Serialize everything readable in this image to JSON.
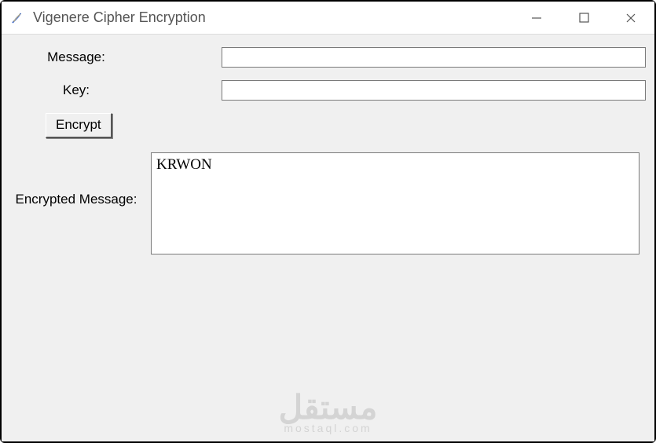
{
  "window": {
    "title": "Vigenere Cipher Encryption"
  },
  "labels": {
    "message": "Message:",
    "key": "Key:",
    "encrypted": "Encrypted Message:"
  },
  "buttons": {
    "encrypt": "Encrypt"
  },
  "inputs": {
    "message_value": "",
    "key_value": ""
  },
  "output": {
    "encrypted_text": "KRWON"
  },
  "watermark": {
    "brand": "مستقل",
    "sub": "mostaql.com"
  }
}
